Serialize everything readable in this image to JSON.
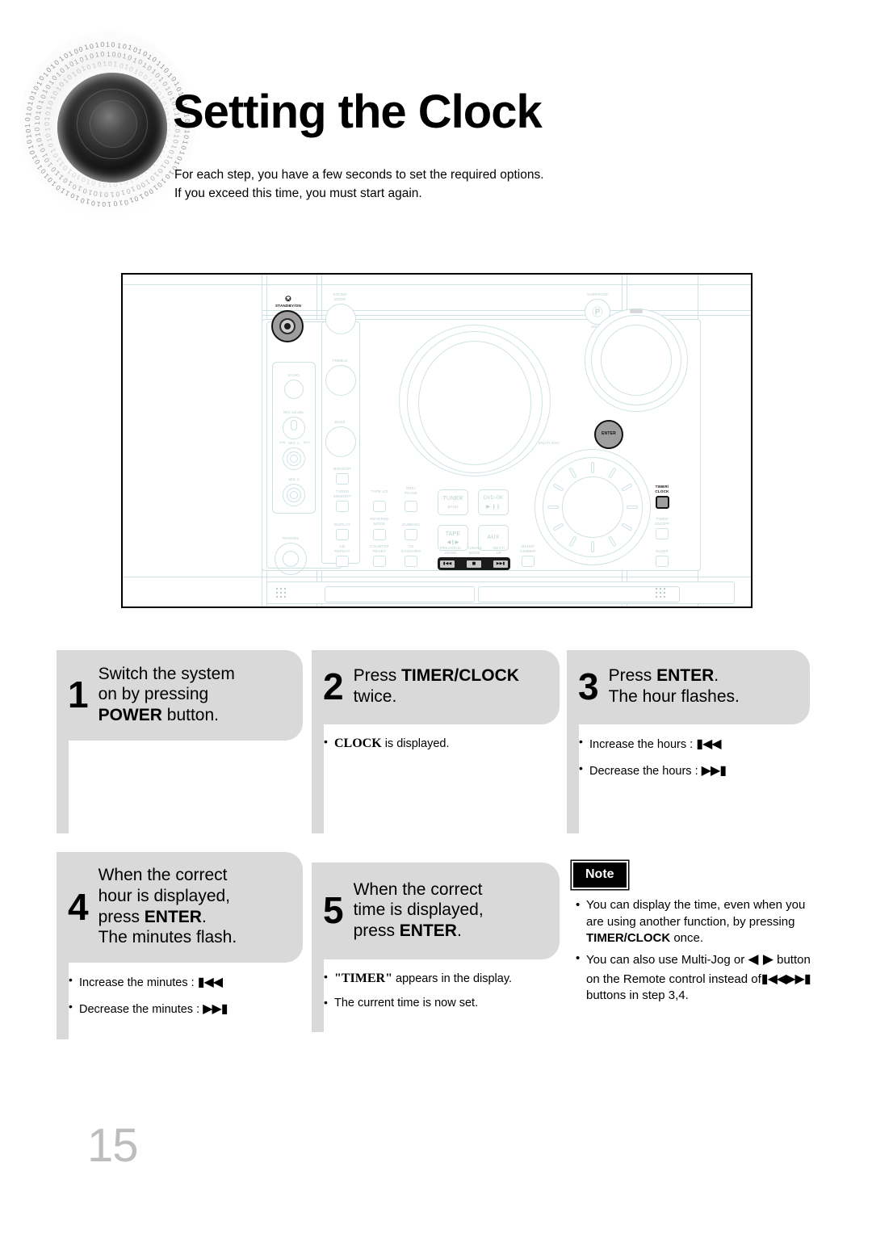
{
  "page": {
    "title": "Setting the Clock",
    "number": "15",
    "intro_line1": "For each step, you have a few seconds to set the required options.",
    "intro_line2": "If you exceed this time, you must start again.",
    "accent_gray": "#d9d9d9",
    "device_line_color": "#cfe2e4",
    "highlight_color": "#9e9e9e"
  },
  "steps": [
    {
      "number": "1",
      "line1": "Switch the system",
      "line2": "on by pressing",
      "line3_bold": "POWER",
      "line3_rest": " button.",
      "bullets": []
    },
    {
      "number": "2",
      "line1_rest": "Press ",
      "line1_bold": "TIMER/CLOCK",
      "line2": "twice.",
      "bullets": [
        {
          "serif": "CLOCK",
          "text": " is displayed."
        }
      ]
    },
    {
      "number": "3",
      "line1_rest": "Press ",
      "line1_bold": "ENTER",
      "line1_tail": ".",
      "line2": "The hour flashes.",
      "bullets": [
        {
          "text": "Increase the hours : ",
          "glyph": "▮◀◀"
        },
        {
          "text": "Decrease the hours : ",
          "glyph": "▶▶▮"
        }
      ]
    },
    {
      "number": "4",
      "line1": "When the correct",
      "line2": "hour is displayed,",
      "line3_rest": "press ",
      "line3_bold": "ENTER",
      "line3_tail": ".",
      "line4": "The minutes flash.",
      "bullets": [
        {
          "text": "Increase the minutes : ",
          "glyph": "▮◀◀"
        },
        {
          "text": "Decrease the minutes : ",
          "glyph": "▶▶▮"
        }
      ]
    },
    {
      "number": "5",
      "line1": "When the correct",
      "line2": "time is displayed,",
      "line3_rest": "press ",
      "line3_bold": "ENTER",
      "line3_tail": ".",
      "bullets": [
        {
          "serif": "\"TIMER\"",
          "text": " appears in the display."
        },
        {
          "text": "The current time is now set."
        }
      ]
    }
  ],
  "note": {
    "badge": "Note",
    "item1_a": "You can display the time, even when you are using another function, by pressing ",
    "item1_bold": "TIMER/CLOCK",
    "item1_b": " once.",
    "item2_a": "You can also  use Multi-Jog or ",
    "item2_arrows": "◀   ▶",
    "item2_b": " button on  the Remote control  instead of",
    "item2_glyph1": "▮◀◀",
    "item2_glyph2": "▶▶▮",
    "item2_c": " buttons in step 3,4."
  },
  "device": {
    "caption_labels": {
      "standby": "STANDBY/ON",
      "sound_mode": "SOUND\nMODE",
      "treble": "TREBLE",
      "bass": "BASS",
      "echo": "ECHO",
      "mic_level": "MIC LEVEL",
      "mic_level_min": "MIN",
      "mic_level_max": "MAX",
      "mic1": "MIC 1",
      "mic2": "MIC 2",
      "phones": "PHONES",
      "mono_st": "MONO/ST",
      "tuner_memory": "TUNER\nMEMORY",
      "display": "DISPLAY",
      "cd_repeat": "CD\nREPEAT",
      "tape_12": "TAPE 1/2",
      "reverse_mode": "REVERSE\nMODE",
      "counter_reset": "COUNTER\nRESET",
      "rec_pause": "REC/\nPAUSE",
      "dubbing": "DUBBING",
      "cd_synchro": "CD\nSYNCHRO",
      "tuner_band_1": "TUNER",
      "tuner_band_2": "BAND",
      "dvd_ok_1": "DVD-OK",
      "dvd_ok_2": "▶·❙❙",
      "tape_1": "TAPE",
      "tape_2": "◀❙▶",
      "aux": "AUX",
      "previous_down": "PREVIOUS/\nDOWN",
      "tuning_mode": "TUNING\nMODE",
      "next_up": "NEXT/\nUP",
      "multi_jog": "MULTI JOG",
      "demo_dimmer": "DEMO/\nDIMMER",
      "timer_clock": "TIMER/\nCLOCK",
      "timer_onoff": "TIMER\nON/OFF",
      "sleep": "SLEEP",
      "surround": "SURROUND",
      "sound_logo": "SOUND",
      "enter": "ENTER"
    },
    "transport": {
      "prev": "▮◀◀",
      "stop": "■",
      "next": "▶▶▮"
    },
    "binary_bits": "010101010101010010101010101010110101010101010101"
  }
}
